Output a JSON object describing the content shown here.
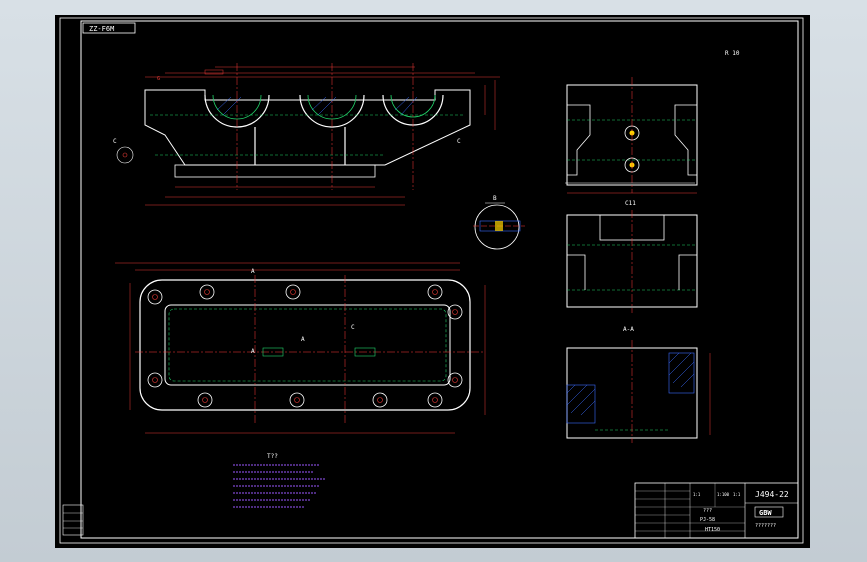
{
  "drawing": {
    "corner_tag": "ZZ-F6M",
    "top_right_mark": "R 10",
    "drawing_number": "J494-22",
    "notes_title": "T??",
    "title_block_center_1": "???",
    "title_block_center_2": "PJ-58",
    "title_block_center_3": "HT150",
    "title_block_logo": "GBW",
    "title_block_under_logo": "???????",
    "title_block_scale_row": [
      "1:1",
      "1:100",
      "1:1"
    ],
    "view_label_a": "A",
    "view_label_b": "B",
    "view_label_c": "C",
    "section_label_aa": "A-A",
    "section_label_c": "C11",
    "detail_label": "B",
    "side_label_c": "C",
    "side_label_g": "G"
  },
  "colors": {
    "background": "#000000",
    "border": "#ffffff",
    "outline": "#ffffff",
    "hidden": "#22d66b",
    "centerline": "#ff3b3b",
    "dimension": "#e53935",
    "section_hatch": "#3a6cff",
    "notes": "#9b59ff",
    "highlight": "#ffd400"
  }
}
